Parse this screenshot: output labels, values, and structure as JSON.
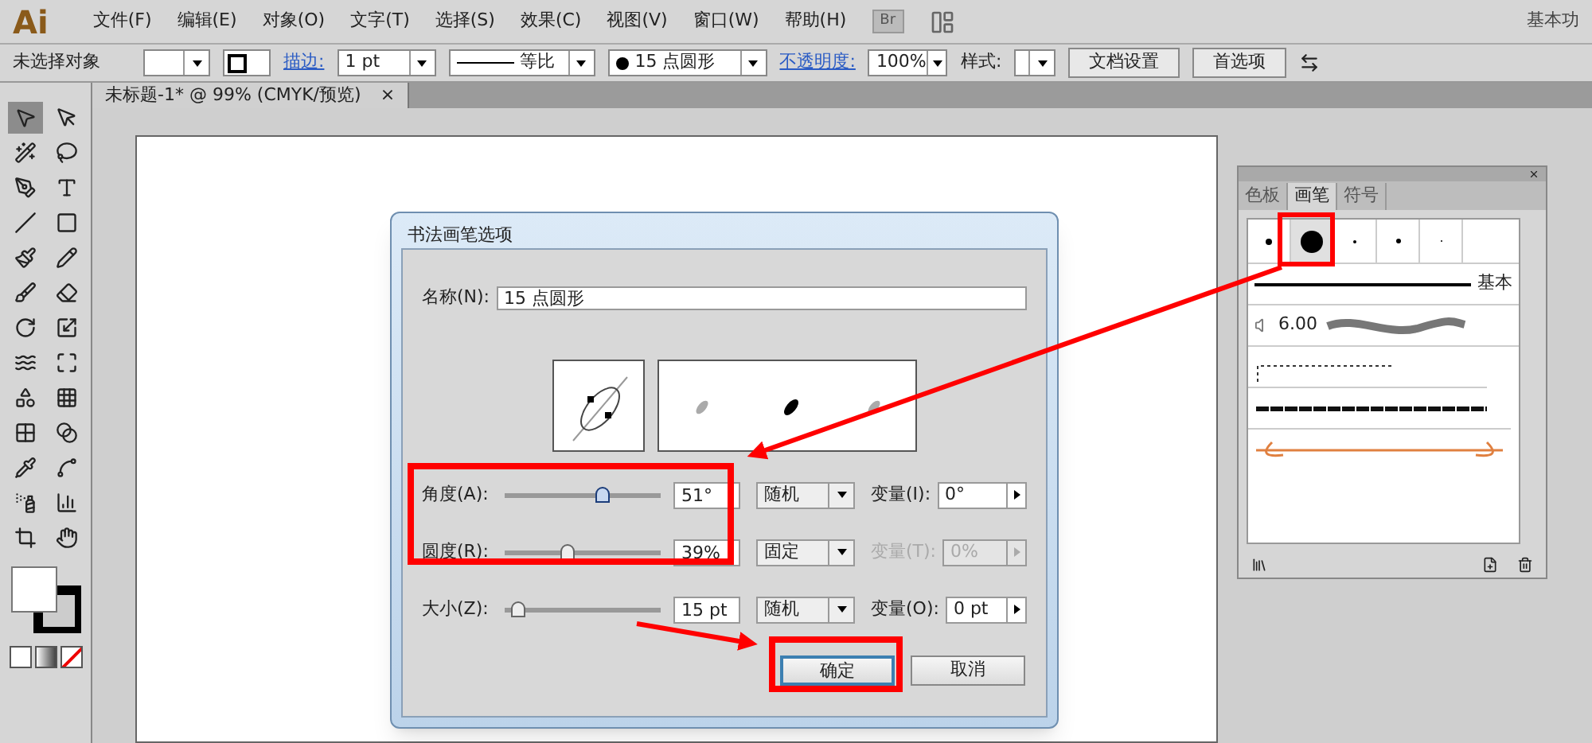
{
  "menubar": {
    "logo": "Ai",
    "items": [
      "文件(F)",
      "编辑(E)",
      "对象(O)",
      "文字(T)",
      "选择(S)",
      "效果(C)",
      "视图(V)",
      "窗口(W)",
      "帮助(H)"
    ],
    "bridge": "Br",
    "workspace": "基本功"
  },
  "control_bar": {
    "selection": "未选择对象",
    "stroke_label": "描边:",
    "stroke_weight": "1 pt",
    "profile": "等比",
    "brush": "15 点圆形",
    "opacity_label": "不透明度:",
    "opacity": "100%",
    "style_label": "样式:",
    "buttons": [
      "文档设置",
      "首选项"
    ]
  },
  "document_tab": {
    "title": "未标题-1* @ 99% (CMYK/预览)",
    "close": "×"
  },
  "tools": [
    {
      "selected": true
    },
    {
      "selected": false
    },
    {
      "selected": false
    },
    {
      "selected": false
    },
    {
      "selected": false
    },
    {
      "selected": false
    },
    {
      "selected": false
    },
    {
      "selected": false
    },
    {
      "selected": false
    },
    {
      "selected": false
    },
    {
      "selected": false
    },
    {
      "selected": false
    },
    {
      "selected": false
    },
    {
      "selected": false
    },
    {
      "selected": false
    },
    {
      "selected": false
    },
    {
      "selected": false
    },
    {
      "selected": false
    },
    {
      "selected": false
    },
    {
      "selected": false
    },
    {
      "selected": false
    },
    {
      "selected": false
    },
    {
      "selected": false
    },
    {
      "selected": false
    },
    {
      "selected": false
    },
    {
      "selected": false
    }
  ],
  "dialog": {
    "title": "书法画笔选项",
    "name_label": "名称(N):",
    "name_value": "15 点圆形",
    "rows": [
      {
        "label": "角度(A):",
        "level": 0.62,
        "value": "51°",
        "mode": "随机",
        "variation_label": "变量(I):",
        "variation": "0°",
        "disabled": false
      },
      {
        "label": "圆度(R):",
        "level": 0.4,
        "value": "39%",
        "mode": "固定",
        "variation_label": "变量(T):",
        "variation": "0%",
        "disabled": true
      },
      {
        "label": "大小(Z):",
        "level": 0.08,
        "value": "15 pt",
        "mode": "随机",
        "variation_label": "变量(O):",
        "variation": "0 pt",
        "disabled": false
      }
    ],
    "buttons": [
      {
        "label": "确定",
        "default": true
      },
      {
        "label": "取消",
        "default": false
      }
    ]
  },
  "brush_panel": {
    "tabs": [
      {
        "label": "色板",
        "selected": false
      },
      {
        "label": "画笔",
        "selected": true
      },
      {
        "label": "符号",
        "selected": false
      }
    ],
    "dots": [
      {
        "selected": false
      },
      {
        "selected": true
      },
      {
        "selected": false
      },
      {
        "selected": false
      },
      {
        "selected": false
      }
    ],
    "basic_label": "基本",
    "scatter_value": "6.00"
  }
}
